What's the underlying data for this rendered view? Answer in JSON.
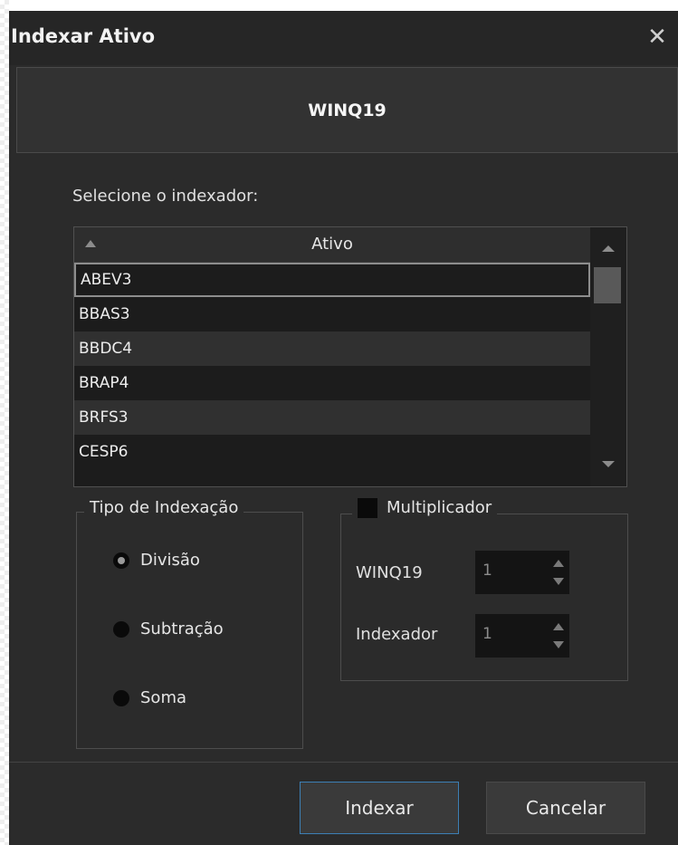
{
  "dialog": {
    "title": "Indexar Ativo",
    "close_icon": "close-icon"
  },
  "header": {
    "asset": "WINQ19"
  },
  "selector": {
    "label": "Selecione o indexador:",
    "column_header": "Ativo",
    "rows": [
      "ABEV3",
      "BBAS3",
      "BBDC4",
      "BRAP4",
      "BRFS3",
      "CESP6"
    ],
    "selected_index": 0
  },
  "indexing_type": {
    "legend": "Tipo de Indexação",
    "options": [
      "Divisão",
      "Subtração",
      "Soma"
    ],
    "selected": "Divisão"
  },
  "multiplier": {
    "legend": "Multiplicador",
    "checked": false,
    "fields": [
      {
        "label": "WINQ19",
        "value": "1"
      },
      {
        "label": "Indexador",
        "value": "1"
      }
    ]
  },
  "buttons": {
    "primary": "Indexar",
    "secondary": "Cancelar"
  },
  "colors": {
    "background": "#2b2b2b",
    "title_bar": "#262626",
    "primary_border": "#3d7fb5"
  }
}
